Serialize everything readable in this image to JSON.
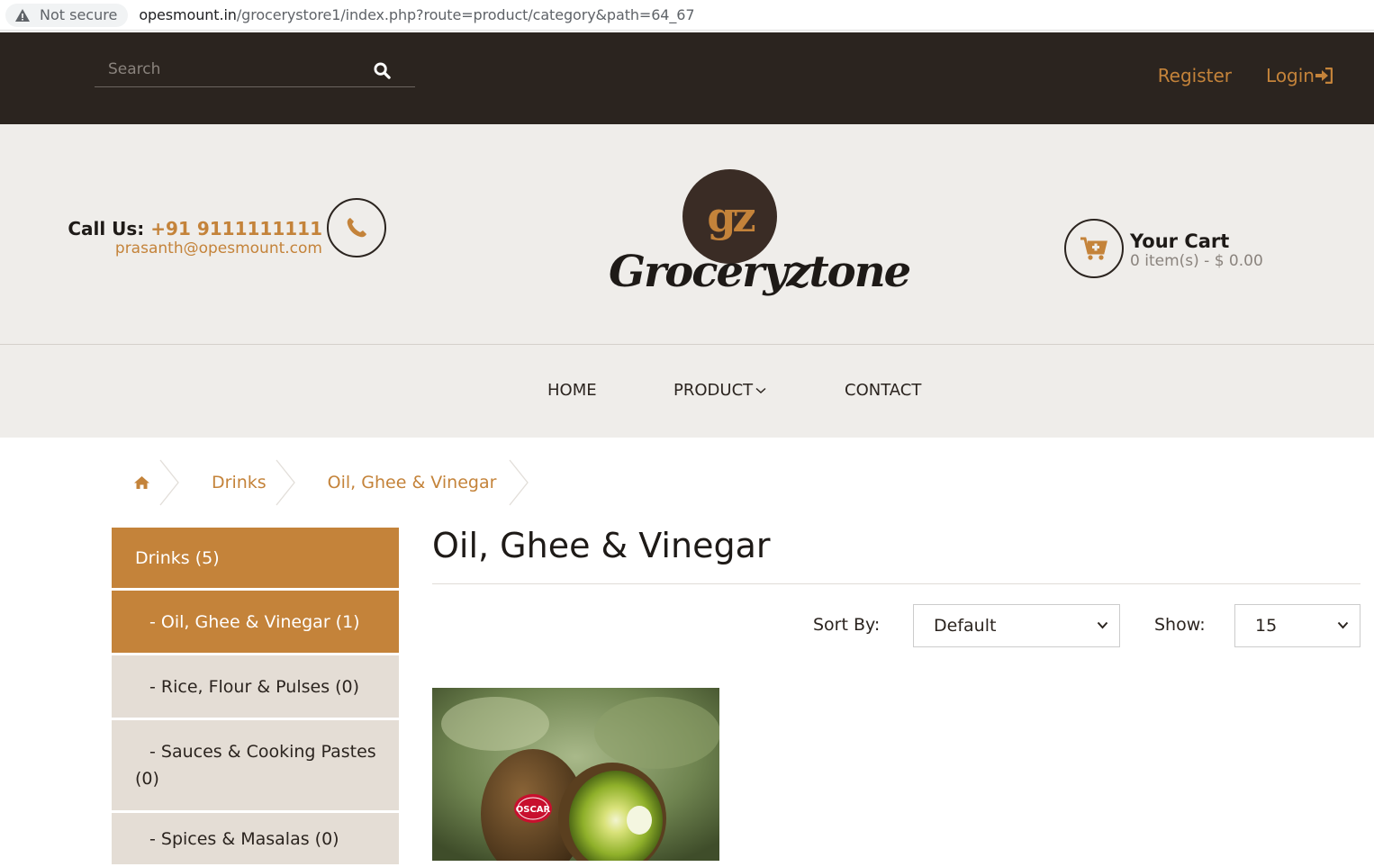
{
  "browser": {
    "security_label": "Not secure",
    "url_host": "opesmount.in",
    "url_path": "/grocerystore1/index.php?route=product/category&path=64_67"
  },
  "topbar": {
    "search_placeholder": "Search",
    "register": "Register",
    "login": "Login"
  },
  "header": {
    "call_label": "Call Us:",
    "phone": "+91 9111111111",
    "email": "prasanth@opesmount.com",
    "logo_mark": "gz",
    "logo_text": "Groceryztone",
    "cart_title": "Your Cart",
    "cart_summary": "0 item(s) - $ 0.00"
  },
  "nav": {
    "home": "HOME",
    "product": "PRODUCT",
    "contact": "CONTACT"
  },
  "breadcrumb": {
    "items": [
      "Drinks",
      "Oil, Ghee & Vinegar"
    ]
  },
  "sidebar": {
    "items": [
      {
        "label": "Drinks (5)"
      },
      {
        "label": "- Oil, Ghee & Vinegar (1)"
      },
      {
        "label": "- Rice, Flour & Pulses (0)"
      },
      {
        "label": "- Sauces & Cooking Pastes (0)"
      },
      {
        "label": "- Spices & Masalas (0)"
      }
    ]
  },
  "main": {
    "title": "Oil, Ghee & Vinegar",
    "sort_label": "Sort By:",
    "sort_value": "Default",
    "show_label": "Show:",
    "show_value": "15",
    "product_badge": "OSCAR"
  },
  "colors": {
    "accent": "#c4833a",
    "dark": "#2b241f",
    "panel": "#efedea",
    "sidebar_bg": "#e4ddd5"
  }
}
